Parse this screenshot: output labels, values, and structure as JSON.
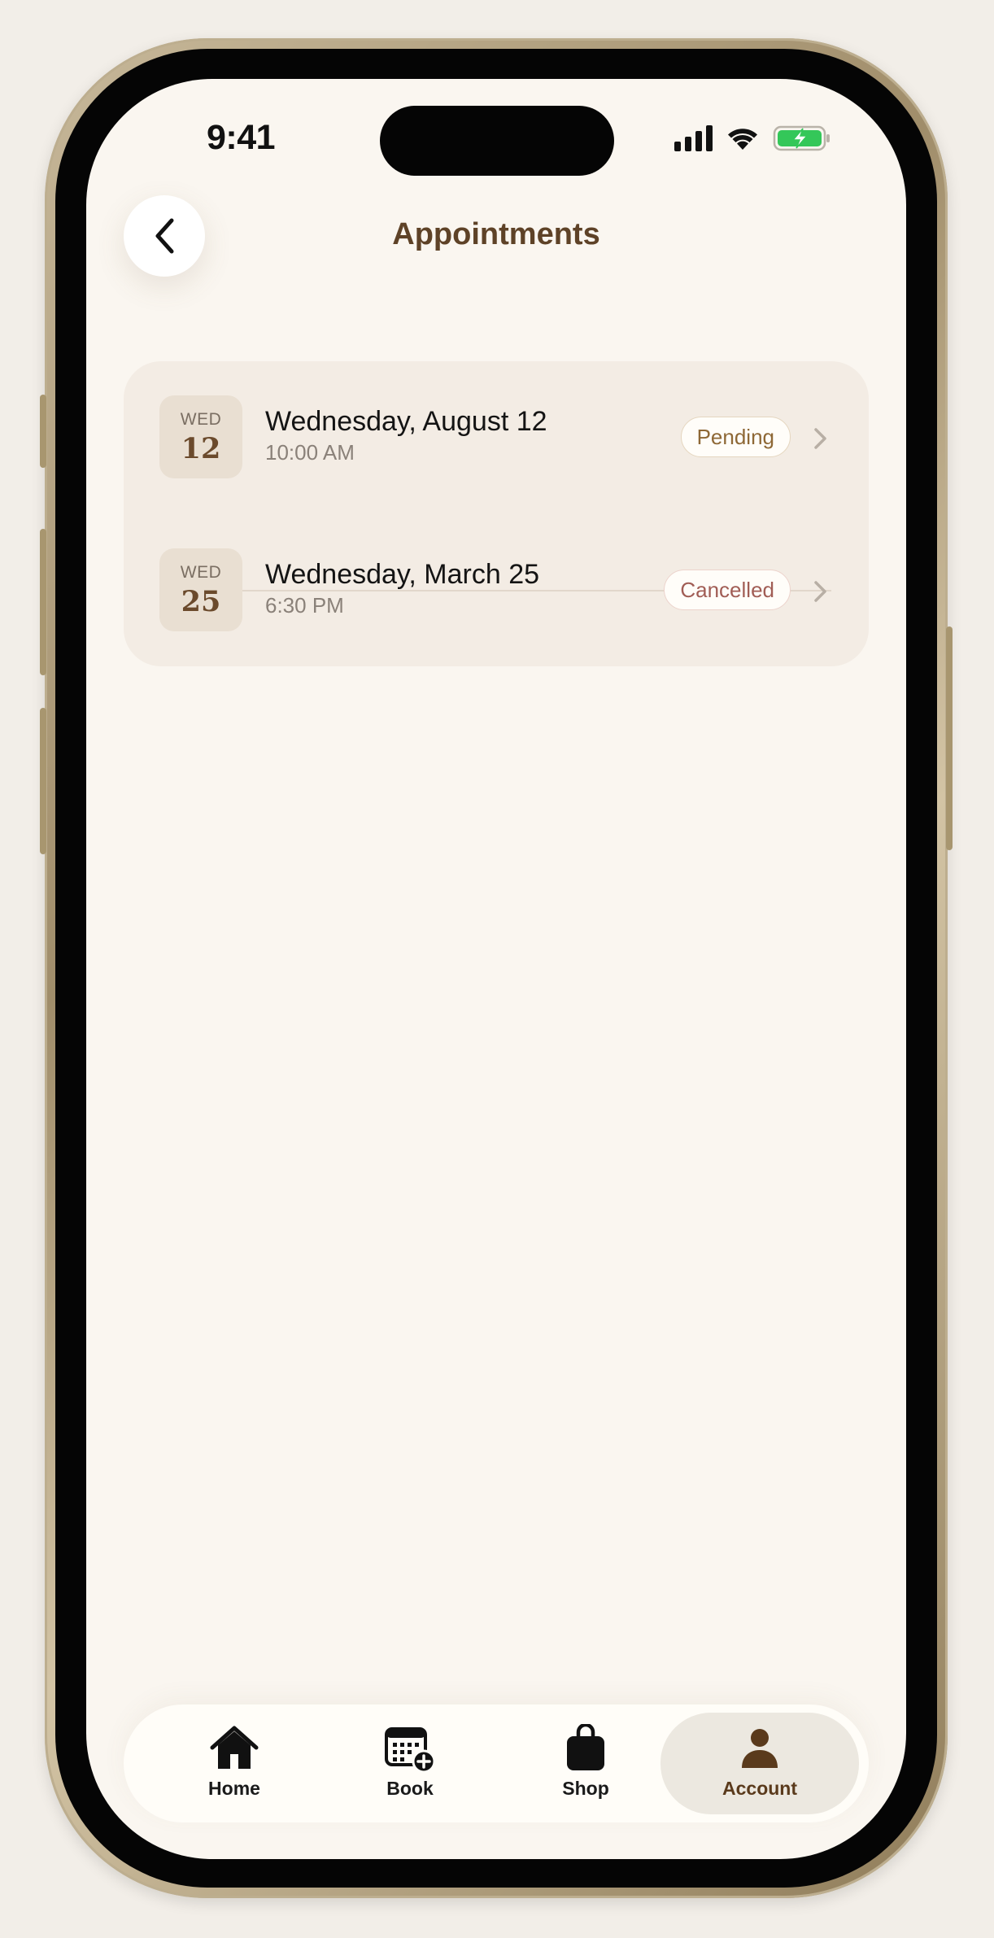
{
  "status_bar": {
    "time": "9:41"
  },
  "header": {
    "title": "Appointments",
    "back_icon": "chevron-left-icon"
  },
  "appointments": [
    {
      "weekday": "WED",
      "day": "12",
      "title": "Wednesday, August 12",
      "time": "10:00 AM",
      "status": "Pending"
    },
    {
      "weekday": "WED",
      "day": "25",
      "title": "Wednesday, March 25",
      "time": "6:30 PM",
      "status": "Cancelled"
    }
  ],
  "tab_bar": {
    "tabs": [
      {
        "label": "Home",
        "icon": "home-icon"
      },
      {
        "label": "Book",
        "icon": "calendar-add-icon"
      },
      {
        "label": "Shop",
        "icon": "shopping-bag-icon"
      },
      {
        "label": "Account",
        "icon": "person-icon",
        "selected": true
      }
    ]
  },
  "colors": {
    "background": "#f2eee8",
    "screen": "#faf6f0",
    "card": "#f3ece4",
    "title_brown": "#5e4227",
    "pending": "#8e6836",
    "cancelled": "#a15d55",
    "battery_green": "#34c759"
  }
}
